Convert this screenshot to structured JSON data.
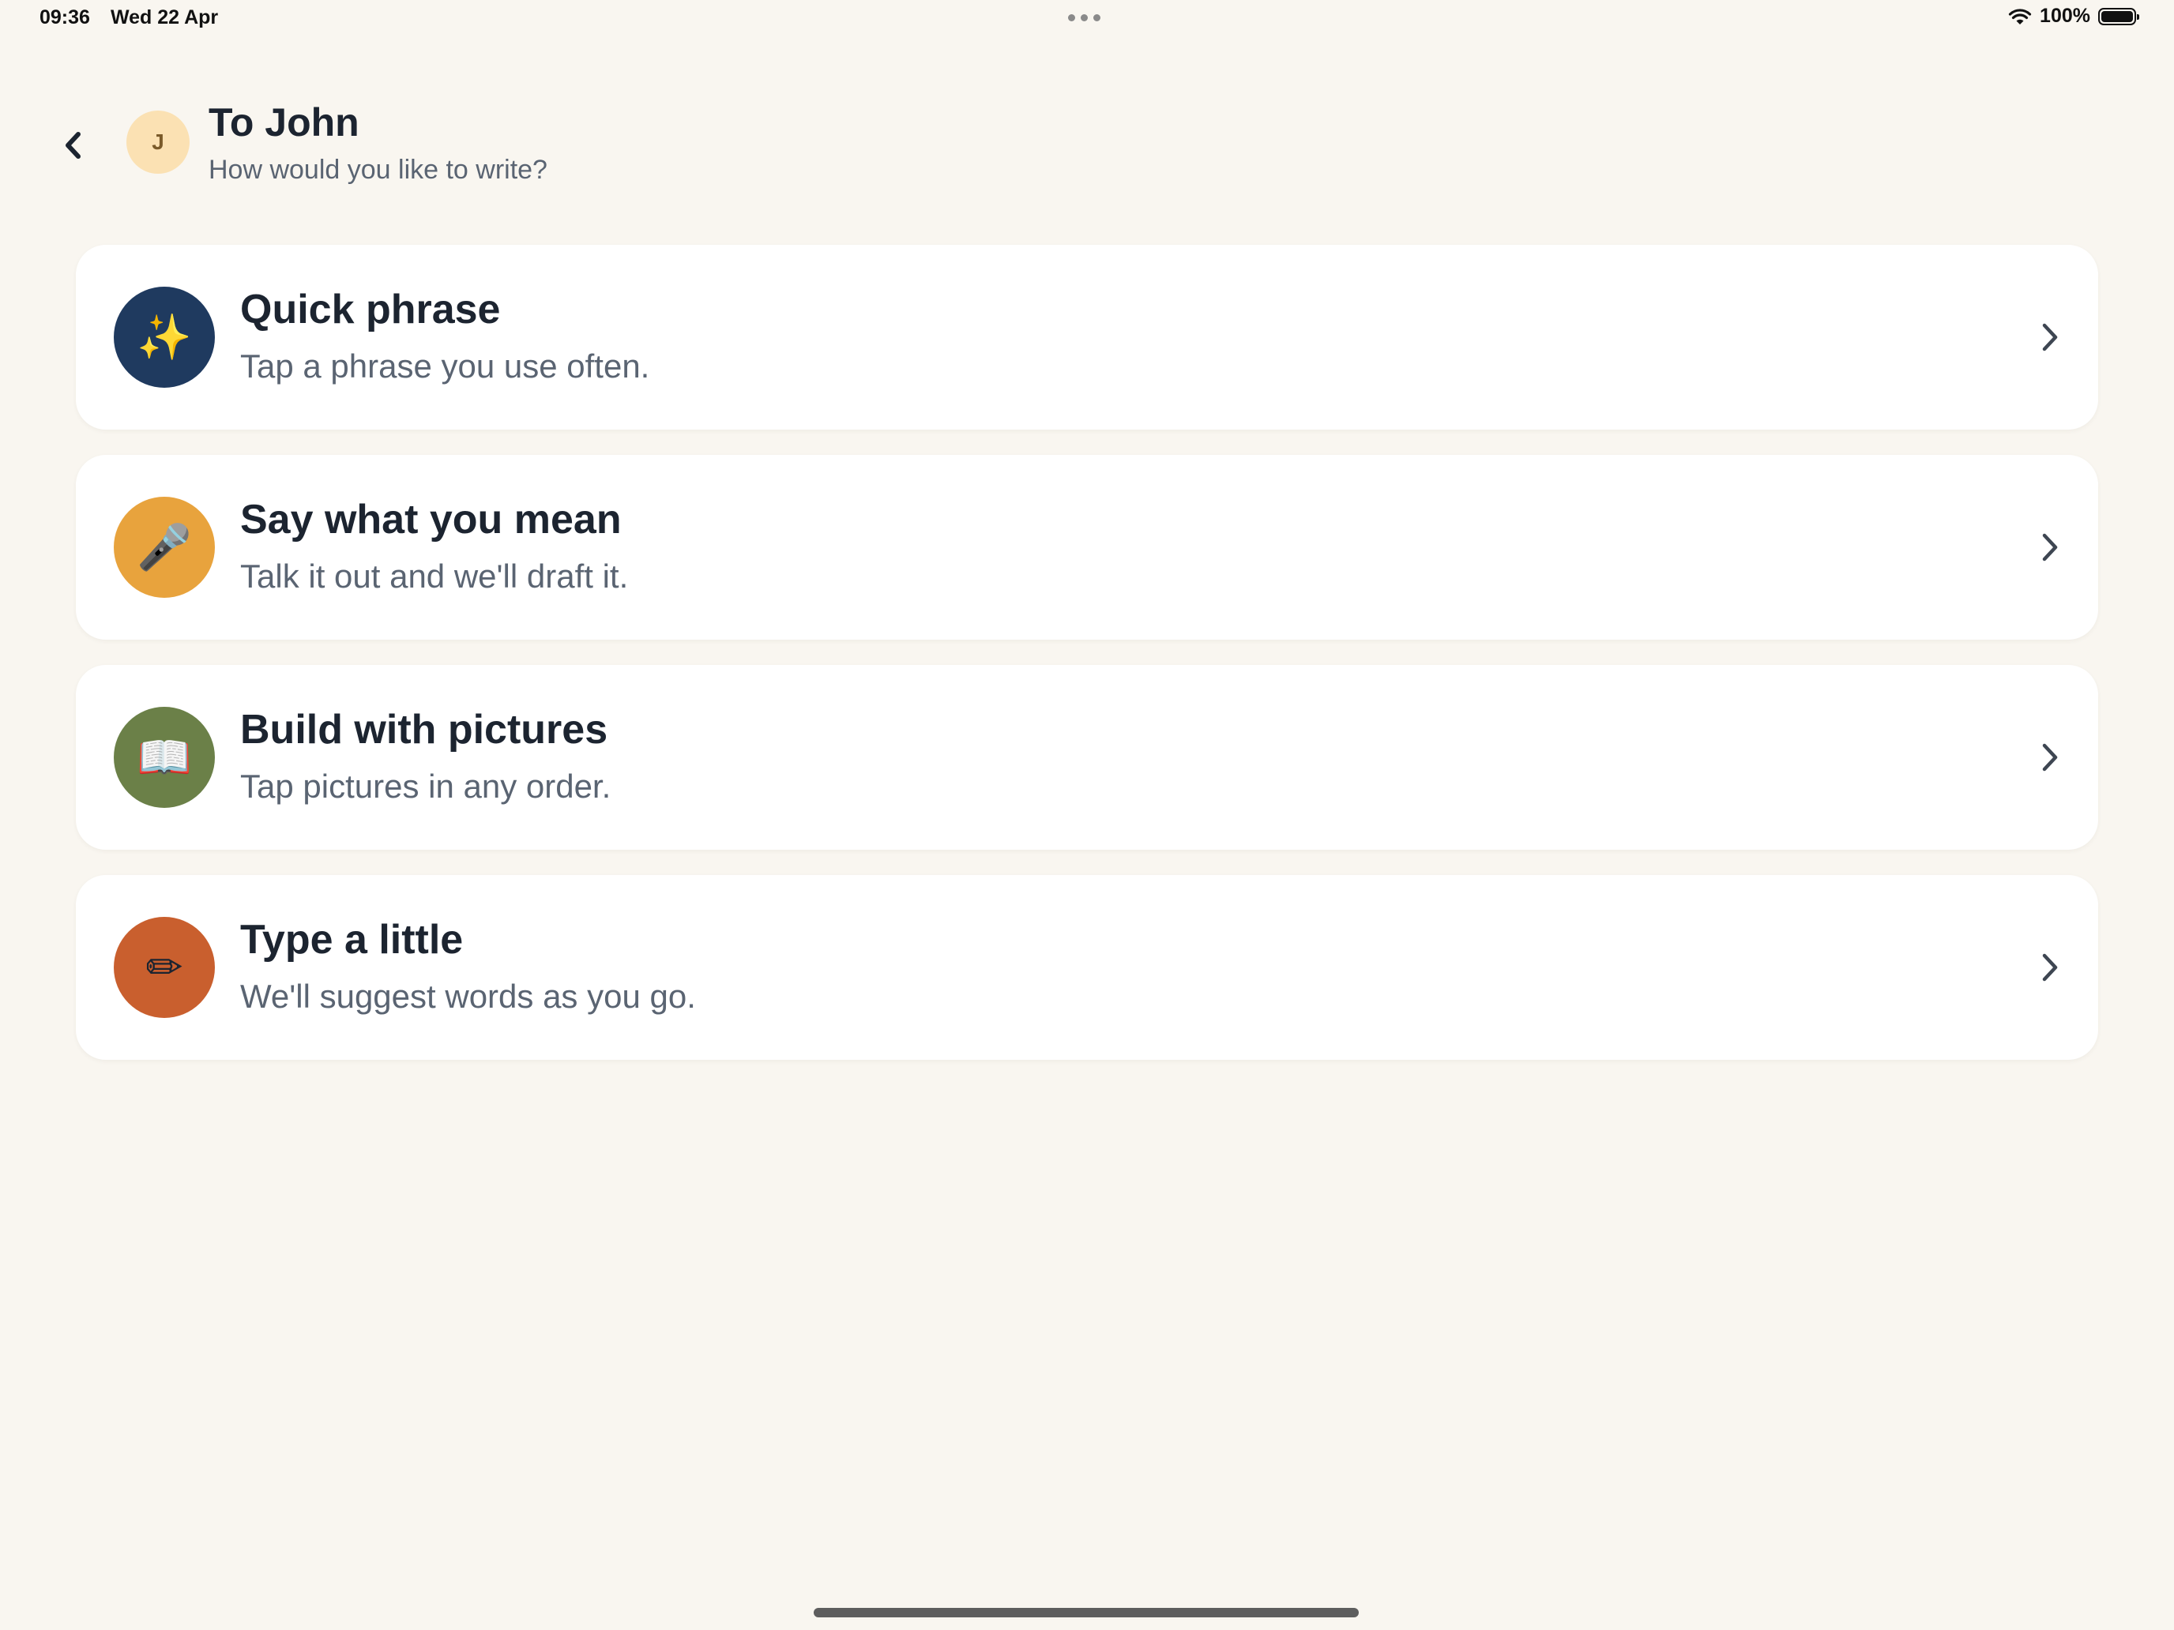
{
  "status_bar": {
    "time": "09:36",
    "date": "Wed 22 Apr",
    "battery": "100%"
  },
  "header": {
    "avatar_initial": "J",
    "title": "To John",
    "subtitle": "How would you like to write?"
  },
  "options": [
    {
      "title": "Quick phrase",
      "description": "Tap a phrase you use often.",
      "icon": "sparkles-icon",
      "glyph": "✨",
      "color": "#1F3A5F"
    },
    {
      "title": "Say what you mean",
      "description": "Talk it out and we'll draft it.",
      "icon": "microphone-icon",
      "glyph": "🎤",
      "color": "#E8A33D"
    },
    {
      "title": "Build with pictures",
      "description": "Tap pictures in any order.",
      "icon": "book-icon",
      "glyph": "📖",
      "color": "#6B8048"
    },
    {
      "title": "Type a little",
      "description": "We'll suggest words as you go.",
      "icon": "pencil-icon",
      "glyph": "✏",
      "color": "#C95F2E"
    }
  ],
  "colors": {
    "background": "#F9F6F0",
    "card": "#FFFFFF",
    "title_text": "#1C2430",
    "secondary_text": "#5A6472",
    "avatar_bg": "#FBE1B3"
  }
}
